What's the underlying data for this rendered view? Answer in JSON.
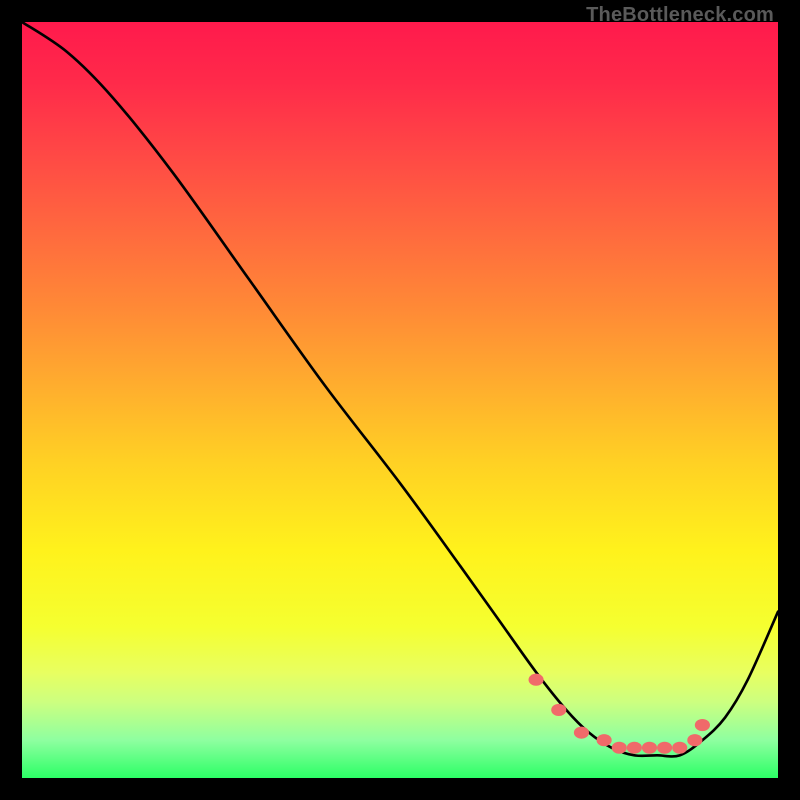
{
  "watermark": "TheBottleneck.com",
  "chart_data": {
    "type": "line",
    "title": "",
    "xlabel": "",
    "ylabel": "",
    "xlim": [
      0,
      100
    ],
    "ylim": [
      0,
      100
    ],
    "grid": false,
    "legend": false,
    "series": [
      {
        "name": "curve",
        "x": [
          0,
          6,
          12,
          20,
          30,
          40,
          50,
          58,
          63,
          68,
          72,
          75,
          78,
          81,
          84,
          87,
          90,
          93,
          96,
          100
        ],
        "y": [
          100,
          96,
          90,
          80,
          66,
          52,
          39,
          28,
          21,
          14,
          9,
          6,
          4,
          3,
          3,
          3,
          5,
          8,
          13,
          22
        ]
      }
    ],
    "markers": {
      "name": "dots",
      "color": "#f06a6a",
      "x": [
        68,
        71,
        74,
        77,
        79,
        81,
        83,
        85,
        87,
        89,
        90
      ],
      "y": [
        13,
        9,
        6,
        5,
        4,
        4,
        4,
        4,
        4,
        5,
        7
      ]
    },
    "green_band_y_range": [
      0,
      3
    ]
  }
}
